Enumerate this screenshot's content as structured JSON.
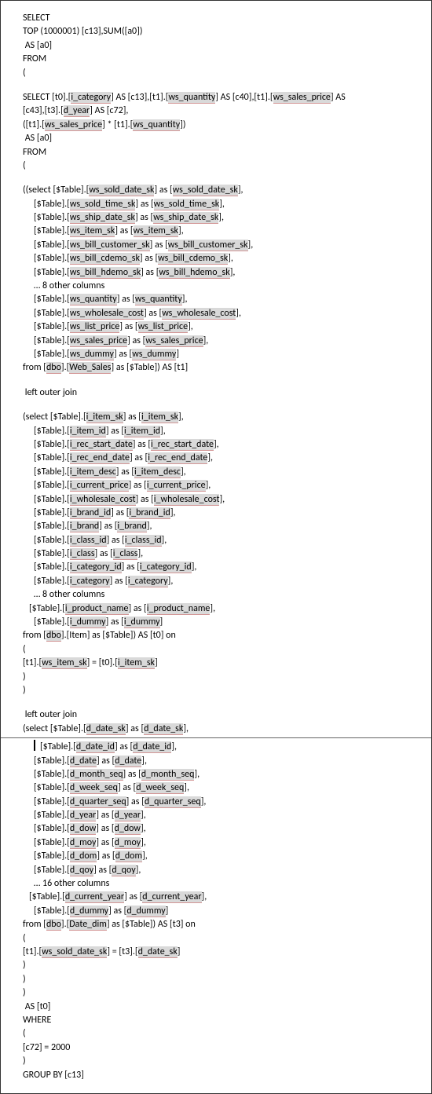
{
  "block1": [
    {
      "t": "SELECT"
    },
    {
      "t": "TOP (1000001) [c13],SUM([a0])"
    },
    {
      "t": " AS [a0]"
    },
    {
      "t": "FROM"
    },
    {
      "t": "("
    }
  ],
  "block2": [
    {
      "pre": "SELECT [t0].[",
      "h": "i_category",
      "post": "] AS [c13],[t1].[",
      "h2": "ws_quantity",
      "post2": "] AS [c40],[t1].[",
      "h3": "ws_sales_price",
      "post3": "] AS"
    },
    {
      "pre": "[c43],[t3].[",
      "h": "d_year",
      "post": "] AS [c72],"
    },
    {
      "pre": "([t1].[",
      "h": "ws_sales_price",
      "mid": "] * [t1].[",
      "h2": "ws_quantity",
      "post": "])"
    },
    {
      "t": " AS [a0]"
    },
    {
      "t": "FROM"
    },
    {
      "t": "("
    }
  ],
  "ws_head": {
    "pre": "((select [$Table].[",
    "h": "ws_sold_date_sk",
    "mid": "] as [",
    "h2": "ws_sold_date_sk",
    "post": "],"
  },
  "ws_cols": [
    "ws_sold_time_sk",
    "ws_ship_date_sk",
    "ws_item_sk",
    "ws_bill_customer_sk",
    "ws_bill_cdemo_sk",
    "ws_bill_hdemo_sk"
  ],
  "ws_other": "… 8 other columns",
  "ws_cols2": [
    "ws_quantity",
    "ws_wholesale_cost",
    "ws_list_price",
    "ws_sales_price",
    "ws_dummy"
  ],
  "ws_from": {
    "pre": "from [",
    "h": "dbo",
    "mid": "].[",
    "h2": "Web_Sales",
    "post": "] as [$Table]) AS [t1]"
  },
  "loj": " left outer join",
  "it_head": {
    "pre": "(select [$Table].[",
    "h": "i_item_sk",
    "mid": "] as [",
    "h2": "i_item_sk",
    "post": "],"
  },
  "it_cols": [
    "i_item_id",
    "i_rec_start_date",
    "i_rec_end_date",
    "i_item_desc",
    "i_current_price",
    "i_wholesale_cost",
    "i_brand_id",
    "i_brand",
    "i_class_id",
    "i_class",
    "i_category_id",
    "i_category"
  ],
  "it_other": "… 8 other columns",
  "it_cols2": [
    "i_product_name",
    "i_dummy"
  ],
  "it_from": {
    "pre": "from [",
    "h": "dbo",
    "mid": "].[Item] as [$Table]) AS [t0] on"
  },
  "it_on": {
    "pre": "[t1].[",
    "h": "ws_item_sk",
    "mid": "] = [t0].[",
    "h2": "i_item_sk",
    "post": "]"
  },
  "dt_head": {
    "pre": "(select [$Table].[",
    "h": "d_date_sk",
    "mid": "] as [",
    "h2": "d_date_sk",
    "post": "],"
  },
  "dt_cols": [
    "d_date_id",
    "d_date",
    "d_month_seq",
    "d_week_seq",
    "d_quarter_seq",
    "d_year",
    "d_dow",
    "d_moy",
    "d_dom",
    "d_qoy"
  ],
  "dt_other": "… 16 other columns",
  "dt_cols2": [
    "d_current_year",
    "d_dummy"
  ],
  "dt_from": {
    "pre": "from [",
    "h": "dbo",
    "mid": "].[",
    "h2": "Date_dim",
    "post": "] as [$Table]) AS [t3] on"
  },
  "dt_on": {
    "pre": "[t1].[",
    "h": "ws_sold_date_sk",
    "mid": "] = [t3].[",
    "h2": "d_date_sk",
    "post": "]"
  },
  "tail": [
    " AS [t0]",
    "WHERE",
    "(",
    "[c72] = 2000",
    ")",
    "GROUP BY [c13]"
  ]
}
